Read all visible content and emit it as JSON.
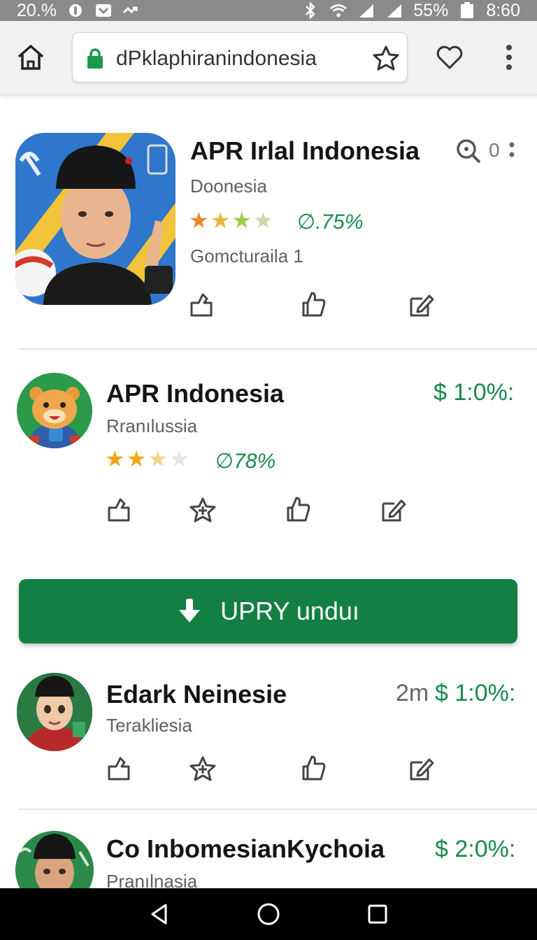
{
  "status_bar": {
    "left_text": "20.%",
    "battery_pct": "55%",
    "time": "8:60"
  },
  "browser": {
    "url": "dPklaphiranindonesia"
  },
  "apps": [
    {
      "title": "APR Irlal Indonesia",
      "subtitle": "Doonesia",
      "rating_stars": 4,
      "rating_pct": "∅.75%",
      "extra_line": "Gomcturaila 1",
      "top_right": "0",
      "actions": [
        "share-icon",
        "thumbs-up-icon",
        "edit-icon"
      ]
    },
    {
      "title": "APR Indonesia",
      "subtitle": "Rranılussia",
      "rating_stars": 2.5,
      "rating_pct": "∅78%",
      "price": "$ 1:0%:",
      "actions": [
        "share-icon",
        "star-add-icon",
        "thumbs-up-icon",
        "edit-icon"
      ]
    },
    {
      "title": "Edark Neinesie",
      "subtitle": "Terakliesia",
      "time": "2m",
      "price": "$ 1:0%:",
      "actions": [
        "share-icon",
        "star-add-icon",
        "thumbs-up-icon",
        "edit-icon"
      ]
    },
    {
      "title": "Co InbomesianKychoia",
      "subtitle": "Pranılnasia",
      "price": "$ 2:0%:"
    }
  ],
  "download_button": {
    "label": "UPRY unduı"
  },
  "colors": {
    "accent_green": "#178a4a",
    "button_green": "#137f42",
    "star_gold": "#f2a51a"
  }
}
